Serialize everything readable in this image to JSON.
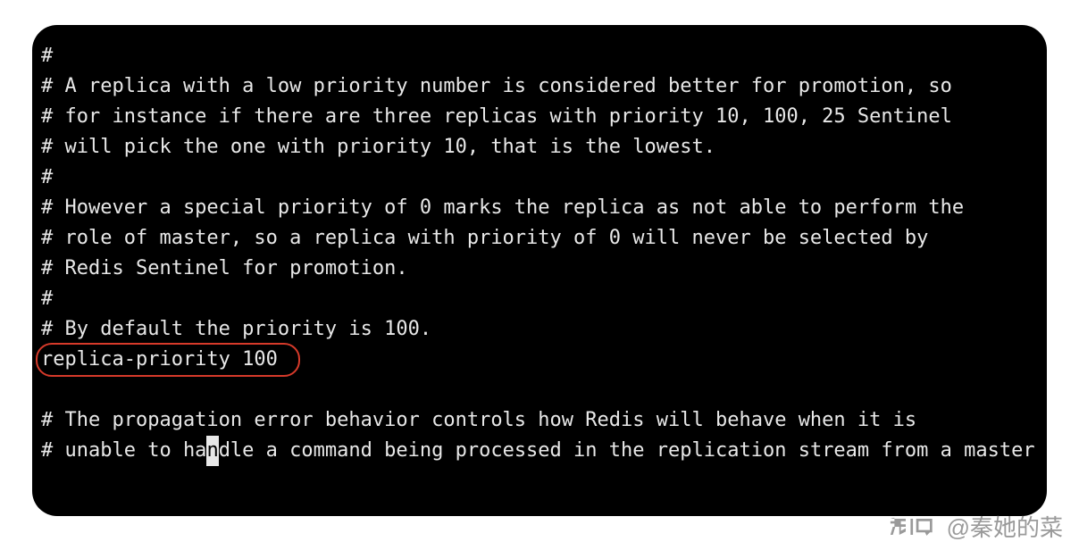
{
  "config": {
    "lines": [
      "#",
      "# A replica with a low priority number is considered better for promotion, so",
      "# for instance if there are three replicas with priority 10, 100, 25 Sentinel",
      "# will pick the one with priority 10, that is the lowest.",
      "#",
      "# However a special priority of 0 marks the replica as not able to perform the",
      "# role of master, so a replica with priority of 0 will never be selected by",
      "# Redis Sentinel for promotion.",
      "#",
      "# By default the priority is 100."
    ],
    "highlighted_line": "replica-priority 100",
    "tail_pre": "# The propagation error behavior controls how Redis will behave when it is\n# unable to ha",
    "tail_cursor_char": "n",
    "tail_post": "dle a command being processed in the replication stream from a master"
  },
  "watermark": {
    "site": "知乎",
    "author": "@秦她的菜"
  }
}
